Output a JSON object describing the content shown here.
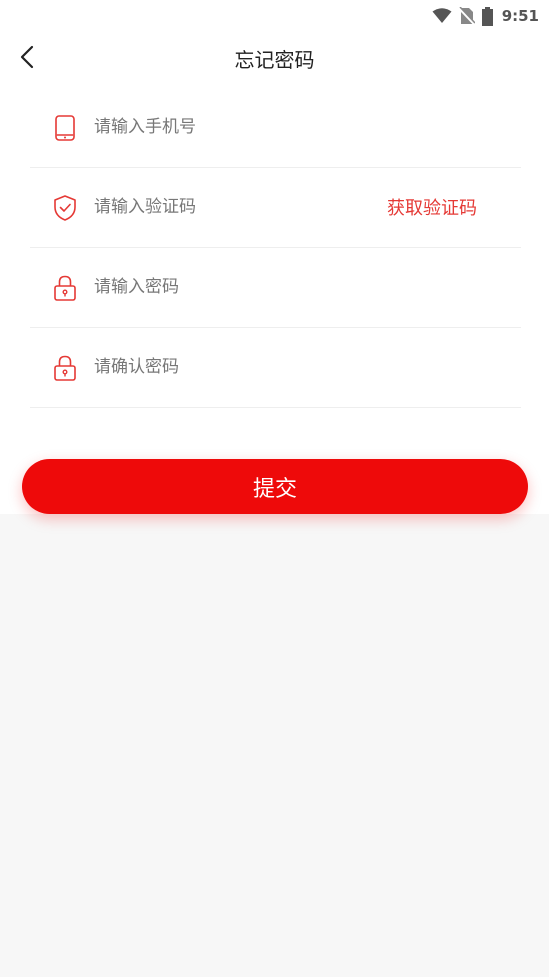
{
  "status_bar": {
    "time": "9:51"
  },
  "header": {
    "title": "忘记密码"
  },
  "form": {
    "phone_placeholder": "请输入手机号",
    "code_placeholder": "请输入验证码",
    "get_code_label": "获取验证码",
    "password_placeholder": "请输入密码",
    "confirm_placeholder": "请确认密码"
  },
  "submit_label": "提交",
  "colors": {
    "accent": "#ee0a0a",
    "link": "#e53935",
    "page_bg": "#f7f7f7"
  }
}
